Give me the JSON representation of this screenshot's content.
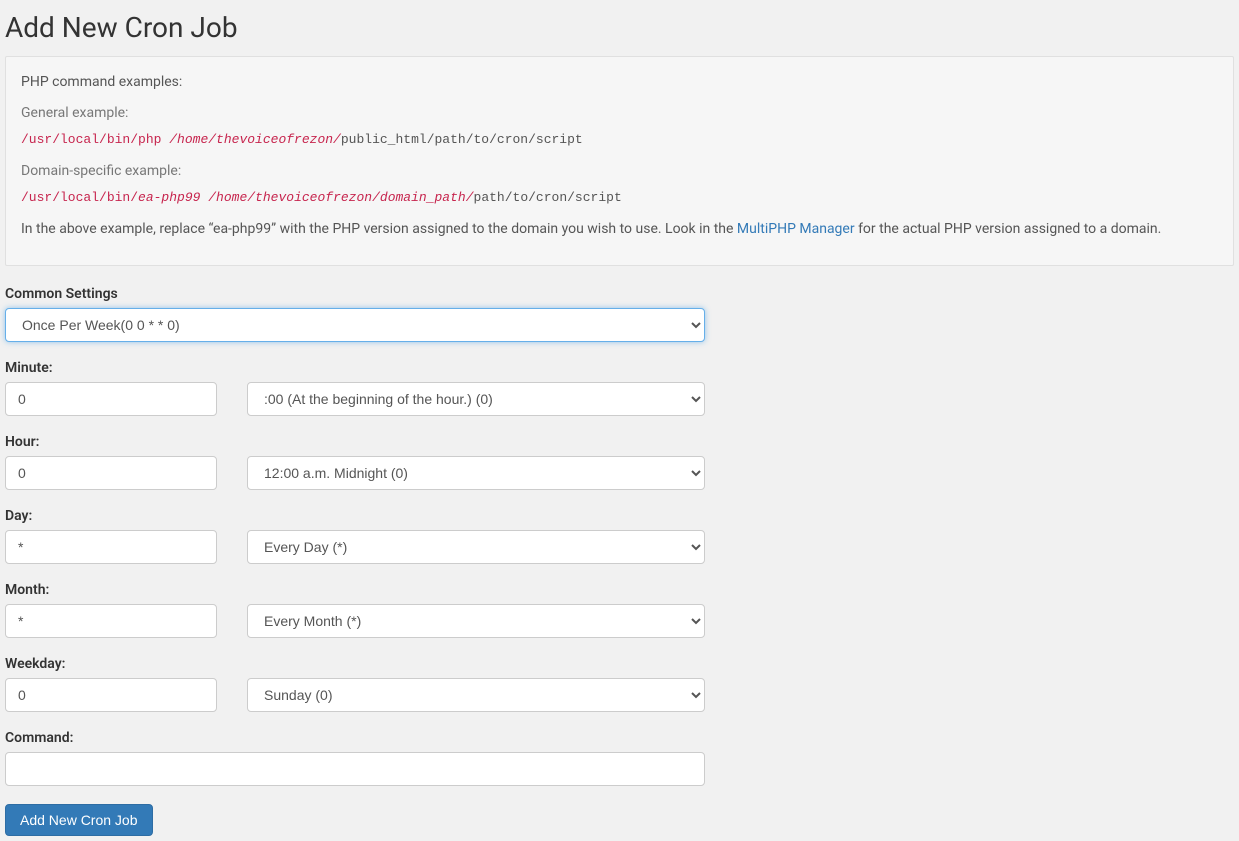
{
  "page_title": "Add New Cron Job",
  "help": {
    "intro": "PHP command examples:",
    "general_heading": "General example:",
    "general_example": {
      "seg1": "/usr/local/bin/php ",
      "seg2": "/home/thevoiceofrezon/",
      "seg3": "public_html/path/to/cron/script"
    },
    "domain_heading": "Domain-specific example:",
    "domain_example": {
      "seg1": "/usr/local/bin/",
      "seg2": "ea-php99 ",
      "seg3": "/home/thevoiceofrezon/",
      "seg4": "domain_path/",
      "seg5": "path/to/cron/script"
    },
    "note_before_link": "In the above example, replace “ea-php99” with the PHP version assigned to the domain you wish to use. Look in the ",
    "link_text": "MultiPHP Manager",
    "note_after_link": " for the actual PHP version assigned to a domain."
  },
  "form": {
    "common_settings": {
      "label": "Common Settings",
      "selected": "Once Per Week(0 0 * * 0)"
    },
    "minute": {
      "label": "Minute:",
      "value": "0",
      "preset": ":00 (At the beginning of the hour.) (0)"
    },
    "hour": {
      "label": "Hour:",
      "value": "0",
      "preset": "12:00 a.m. Midnight (0)"
    },
    "day": {
      "label": "Day:",
      "value": "*",
      "preset": "Every Day (*)"
    },
    "month": {
      "label": "Month:",
      "value": "*",
      "preset": "Every Month (*)"
    },
    "weekday": {
      "label": "Weekday:",
      "value": "0",
      "preset": "Sunday (0)"
    },
    "command": {
      "label": "Command:",
      "value": ""
    },
    "submit_label": "Add New Cron Job"
  }
}
